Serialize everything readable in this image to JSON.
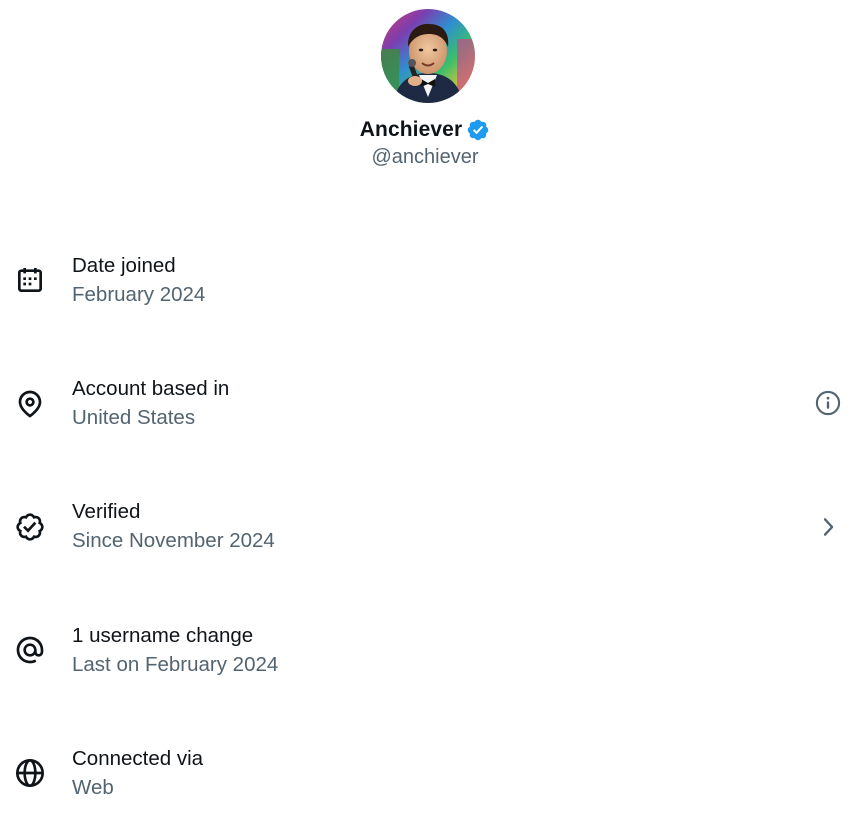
{
  "profile": {
    "display_name": "Anchiever",
    "handle": "@anchiever",
    "verified": true,
    "badge_color": "#1d9bf0"
  },
  "colors": {
    "primary_text": "#0f1419",
    "secondary_text": "#536471",
    "background": "#ffffff"
  },
  "rows": [
    {
      "icon": "calendar-icon",
      "title": "Date joined",
      "subtitle": "February 2024"
    },
    {
      "icon": "location-pin-icon",
      "title": "Account based in",
      "subtitle": "United States",
      "action_icon": "info-icon"
    },
    {
      "icon": "verified-badge-outline-icon",
      "title": "Verified",
      "subtitle": "Since November 2024",
      "action_icon": "chevron-right-icon"
    },
    {
      "icon": "at-sign-icon",
      "title": "1 username change",
      "subtitle": "Last on February 2024"
    },
    {
      "icon": "globe-icon",
      "title": "Connected via",
      "subtitle": "Web"
    }
  ]
}
